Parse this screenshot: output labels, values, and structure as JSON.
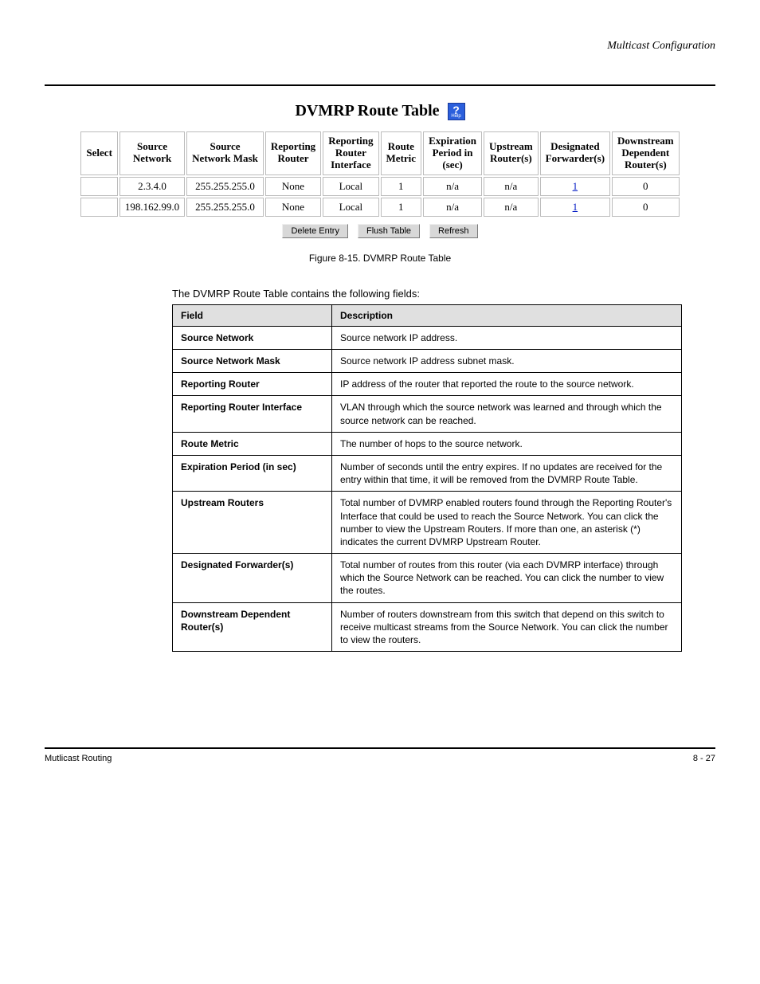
{
  "section_header": "Multicast Configuration",
  "rt": {
    "title": "DVMRP Route Table",
    "help_sub": "Help",
    "headers": {
      "select": "Select",
      "src_net": "Source\nNetwork",
      "src_mask": "Source\nNetwork Mask",
      "rep_router": "Reporting\nRouter",
      "rep_iface": "Reporting\nRouter\nInterface",
      "metric": "Route\nMetric",
      "expire": "Expiration\nPeriod in\n(sec)",
      "upstream": "Upstream\nRouter(s)",
      "desig": "Designated\nForwarder(s)",
      "depend": "Downstream\nDependent\nRouter(s)"
    },
    "rows": [
      {
        "select": "",
        "src_net": "2.3.4.0",
        "src_mask": "255.255.255.0",
        "rep_router": "None",
        "rep_iface": "Local",
        "metric": "1",
        "expire": "n/a",
        "upstream": "n/a",
        "desig": "1",
        "depend": "0"
      },
      {
        "select": "",
        "src_net": "198.162.99.0",
        "src_mask": "255.255.255.0",
        "rep_router": "None",
        "rep_iface": "Local",
        "metric": "1",
        "expire": "n/a",
        "upstream": "n/a",
        "desig": "1",
        "depend": "0"
      }
    ],
    "buttons": {
      "delete": "Delete Entry",
      "flush": "Flush Table",
      "refresh": "Refresh"
    }
  },
  "figure_caption": "Figure 8-15. DVMRP Route Table",
  "fields_intro": "The DVMRP Route Table contains the following fields:",
  "fields": {
    "col1": "Field",
    "col2": "Description",
    "rows": [
      {
        "name": "Source Network",
        "desc": "Source network IP address."
      },
      {
        "name": "Source Network Mask",
        "desc": "Source network IP address subnet mask."
      },
      {
        "name": "Reporting Router",
        "desc": "IP address of the router that reported the route to the source network."
      },
      {
        "name": "Reporting Router Interface",
        "desc": "VLAN through which the source network was learned and through which the source network can be reached."
      },
      {
        "name": "Route Metric",
        "desc": "The number of hops to the source network."
      },
      {
        "name": "Expiration Period (in sec)",
        "desc": "Number of seconds until the entry expires. If no updates are received for the entry within that time, it will be removed from the DVMRP Route Table."
      },
      {
        "name": "Upstream Routers",
        "desc": "Total number of DVMRP enabled routers found through the Reporting Router's Interface that could be used to reach the Source Network. You can click the number to view the Upstream Routers. If more than one, an asterisk (*) indicates the current DVMRP Upstream Router."
      },
      {
        "name": "Designated Forwarder(s)",
        "desc": "Total number of routes from this router (via each DVMRP interface) through which the Source Network can be reached. You can click the number to view the routes."
      },
      {
        "name": "Downstream Dependent Router(s)",
        "desc": "Number of routers downstream from this switch that depend on this switch to receive multicast streams from the Source Network. You can click the number to view the routers."
      }
    ]
  },
  "footer": {
    "left": "Mutlicast Routing",
    "right": "8 - 27"
  }
}
